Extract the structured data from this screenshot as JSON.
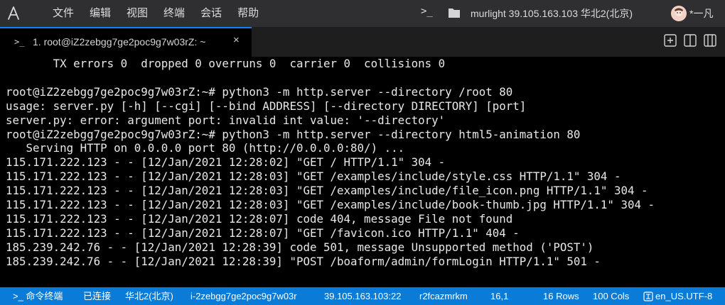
{
  "menu": [
    "文件",
    "编辑",
    "视图",
    "终端",
    "会话",
    "帮助"
  ],
  "header": {
    "terminal_button": ">_",
    "server": "murlight 39.105.163.103 华北2(北京)",
    "user": "*一凡"
  },
  "tab": {
    "prompt": ">_",
    "title": "1. root@iZ2zebgg7ge2poc9g7w03rZ: ~",
    "close": "×"
  },
  "terminal": {
    "lines": [
      "       TX errors 0  dropped 0 overruns 0  carrier 0  collisions 0",
      "",
      "root@iZ2zebgg7ge2poc9g7w03rZ:~# python3 -m http.server --directory /root 80",
      "usage: server.py [-h] [--cgi] [--bind ADDRESS] [--directory DIRECTORY] [port]",
      "server.py: error: argument port: invalid int value: '--directory'",
      "root@iZ2zebgg7ge2poc9g7w03rZ:~# python3 -m http.server --directory html5-animation 80",
      "   Serving HTTP on 0.0.0.0 port 80 (http://0.0.0.0:80/) ...",
      "115.171.222.123 - - [12/Jan/2021 12:28:02] \"GET / HTTP/1.1\" 304 -",
      "115.171.222.123 - - [12/Jan/2021 12:28:03] \"GET /examples/include/style.css HTTP/1.1\" 304 -",
      "115.171.222.123 - - [12/Jan/2021 12:28:03] \"GET /examples/include/file_icon.png HTTP/1.1\" 304 -",
      "115.171.222.123 - - [12/Jan/2021 12:28:03] \"GET /examples/include/book-thumb.jpg HTTP/1.1\" 304 -",
      "115.171.222.123 - - [12/Jan/2021 12:28:07] code 404, message File not found",
      "115.171.222.123 - - [12/Jan/2021 12:28:07] \"GET /favicon.ico HTTP/1.1\" 404 -",
      "185.239.242.76 - - [12/Jan/2021 12:28:39] code 501, message Unsupported method ('POST')",
      "185.239.242.76 - - [12/Jan/2021 12:28:39] \"POST /boaform/admin/formLogin HTTP/1.1\" 501 -"
    ]
  },
  "status": {
    "mode": ">_ 命令终端",
    "connection": "已连接",
    "region": "华北2(北京)",
    "instance": "i-2zebgg7ge2poc9g7w03r",
    "address": "39.105.163.103:22",
    "session": "r2fcazmrkm",
    "cursor": "16,1",
    "rows": "16 Rows",
    "cols": "100 Cols",
    "encoding": "en_US.UTF-8"
  },
  "colors": {
    "title_bar": "#2f2f31",
    "status_bar": "#0a7bd6",
    "tab_accent": "#0a84ff",
    "terminal_bg": "#000000",
    "terminal_fg": "#e8e8e8"
  },
  "icons": [
    "app-logo-icon",
    "folder-icon",
    "add-tab-icon",
    "split-vertical-icon",
    "split-horizontal-icon",
    "encoding-icon"
  ]
}
